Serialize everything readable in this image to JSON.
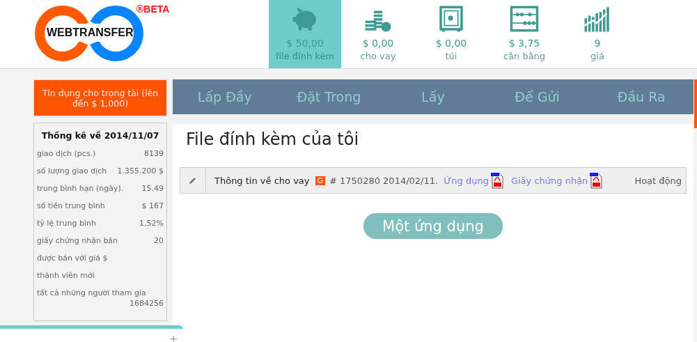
{
  "logo": {
    "text": "WEBTRANSFER",
    "badge": "®BETA"
  },
  "stats": [
    {
      "kind": "piggy",
      "value": "$ 50,00",
      "label": "file đính kèm",
      "selected": true
    },
    {
      "kind": "coins",
      "value": "$ 0,00",
      "label": "cho vay",
      "selected": false
    },
    {
      "kind": "safe",
      "value": "$ 0,00",
      "label": "túi",
      "selected": false
    },
    {
      "kind": "abacus",
      "value": "$ 3,75",
      "label": "cân bằng",
      "selected": false
    },
    {
      "kind": "growth",
      "value": "9",
      "label": "giá",
      "selected": false
    }
  ],
  "credit_button": "Tín dụng cho trọng tài (lên đến $ 1,000)",
  "stats_panel": {
    "title": "Thống kê về 2014/11/07",
    "rows": [
      {
        "label": "giao dịch (pcs.)",
        "value": "8139"
      },
      {
        "label": "số lượng giao dịch",
        "value": "1.355.200 $"
      },
      {
        "label": "trung bình hạn (ngày).",
        "value": "15.49"
      },
      {
        "label": "số tiền trung bình",
        "value": "$ 167"
      },
      {
        "label": "tỷ lệ trung bình",
        "value": "1,52%"
      },
      {
        "label": "giấy chứng nhận bán",
        "value": "20"
      },
      {
        "label": "được bán với giá $"
      },
      {
        "label": "thành viên mới"
      },
      {
        "label": "tất cả những người tham gia",
        "value": "1684256"
      }
    ]
  },
  "nav": [
    "Lấp Đầy",
    "Đặt Trong",
    "Lấy",
    "Để Gửi",
    "Đầu Ra"
  ],
  "page_title": "File đính kèm của tôi",
  "attachment": {
    "title": "Thông tin về cho vay",
    "badge": "G",
    "number": "# 1750280 2014/02/11.",
    "links": [
      "Ứng dụng",
      "Giấy chứng nhận"
    ],
    "status": "Hoạt động"
  },
  "action_button": "Một ứng dụng",
  "chat_widget": {
    "button": "+"
  }
}
